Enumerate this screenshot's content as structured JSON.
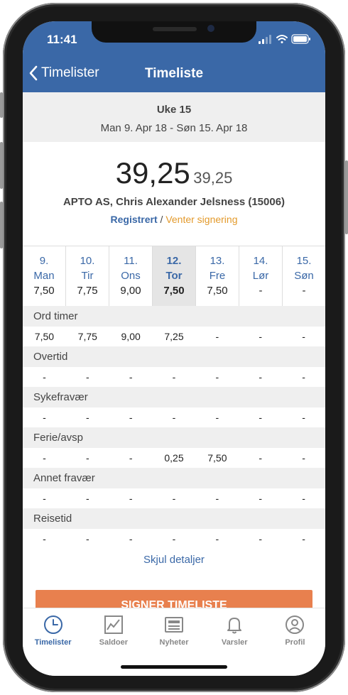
{
  "status_bar": {
    "time": "11:41"
  },
  "nav": {
    "back_label": "Timelister",
    "title": "Timeliste"
  },
  "week": {
    "label": "Uke 15",
    "range": "Man 9. Apr 18 - Søn 15. Apr 18"
  },
  "summary": {
    "total": "39,25",
    "total_small": "39,25",
    "company": "APTO AS, Chris Alexander Jelsness (15006)",
    "status_registered": "Registrert",
    "status_separator": " / ",
    "status_waiting": "Venter signering"
  },
  "days": [
    {
      "num": "9.",
      "wd": "Man",
      "hours": "7,50"
    },
    {
      "num": "10.",
      "wd": "Tir",
      "hours": "7,75"
    },
    {
      "num": "11.",
      "wd": "Ons",
      "hours": "9,00"
    },
    {
      "num": "12.",
      "wd": "Tor",
      "hours": "7,50",
      "selected": true
    },
    {
      "num": "13.",
      "wd": "Fre",
      "hours": "7,50"
    },
    {
      "num": "14.",
      "wd": "Lør",
      "hours": "-"
    },
    {
      "num": "15.",
      "wd": "Søn",
      "hours": "-"
    }
  ],
  "categories": [
    {
      "name": "Ord timer",
      "values": [
        "7,50",
        "7,75",
        "9,00",
        "7,25",
        "-",
        "-",
        "-"
      ]
    },
    {
      "name": "Overtid",
      "values": [
        "-",
        "-",
        "-",
        "-",
        "-",
        "-",
        "-"
      ]
    },
    {
      "name": "Sykefravær",
      "values": [
        "-",
        "-",
        "-",
        "-",
        "-",
        "-",
        "-"
      ]
    },
    {
      "name": "Ferie/avsp",
      "values": [
        "-",
        "-",
        "-",
        "0,25",
        "7,50",
        "-",
        "-"
      ]
    },
    {
      "name": "Annet fravær",
      "values": [
        "-",
        "-",
        "-",
        "-",
        "-",
        "-",
        "-"
      ]
    },
    {
      "name": "Reisetid",
      "values": [
        "-",
        "-",
        "-",
        "-",
        "-",
        "-",
        "-"
      ]
    }
  ],
  "toggle_label": "Skjul detaljer",
  "sign_button": "SIGNER TIMELISTE",
  "tabs": [
    {
      "label": "Timelister",
      "icon": "clock-icon",
      "active": true
    },
    {
      "label": "Saldoer",
      "icon": "chart-icon"
    },
    {
      "label": "Nyheter",
      "icon": "newspaper-icon"
    },
    {
      "label": "Varsler",
      "icon": "bell-icon"
    },
    {
      "label": "Profil",
      "icon": "profile-icon"
    }
  ],
  "colors": {
    "primary": "#3a68a7",
    "accent": "#e8804e",
    "pending": "#e39a2c"
  }
}
